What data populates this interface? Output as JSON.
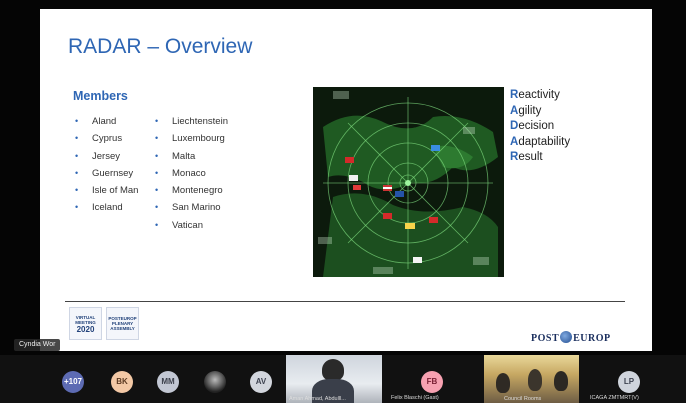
{
  "slide": {
    "title": "RADAR – Overview",
    "members_heading": "Members",
    "members_col1": [
      "Aland",
      "Cyprus",
      "Jersey",
      "Guernsey",
      "Isle of Man",
      "Iceland"
    ],
    "members_col2": [
      "Liechtenstein",
      "Luxembourg",
      "Malta",
      "Monaco",
      "Montenegro",
      "San Marino",
      "Vatican"
    ],
    "acronym": [
      {
        "first": "R",
        "rest": "eactivity"
      },
      {
        "first": "A",
        "rest": "gility"
      },
      {
        "first": "D",
        "rest": "ecision"
      },
      {
        "first": "A",
        "rest": "daptability"
      },
      {
        "first": "R",
        "rest": "esult"
      }
    ],
    "logo1_lines": [
      "VIRTUAL",
      "MEETING",
      "2020"
    ],
    "logo2_lines": [
      "POSTEUROP",
      "PLENARY",
      "ASSEMBLY"
    ],
    "brand_left": "POST",
    "brand_right": "EUROP",
    "accent_color": "#2e66b4"
  },
  "presenter_tag": "Cyndia Wor",
  "participants": [
    {
      "kind": "avatar",
      "initials": "+107",
      "color": "#5d6bb3"
    },
    {
      "kind": "avatar",
      "initials": "BK",
      "color": "#f3c8a5"
    },
    {
      "kind": "avatar",
      "initials": "MM",
      "color": "#c2c7d3"
    },
    {
      "kind": "avatar-photo",
      "initials": ""
    },
    {
      "kind": "avatar",
      "initials": "AV",
      "color": "#d2d6dd"
    },
    {
      "kind": "video",
      "label": "Aman Ahmad, Abdulll..."
    },
    {
      "kind": "avatar",
      "initials": "FB",
      "color": "#f7a1b1",
      "label": "Felix Blaschi (Gast)"
    },
    {
      "kind": "video",
      "label": "Council Rooms"
    },
    {
      "kind": "avatar",
      "initials": "LP",
      "color": "#cfd4dc",
      "label": "ICAGA ZMTMRT(V)"
    }
  ]
}
